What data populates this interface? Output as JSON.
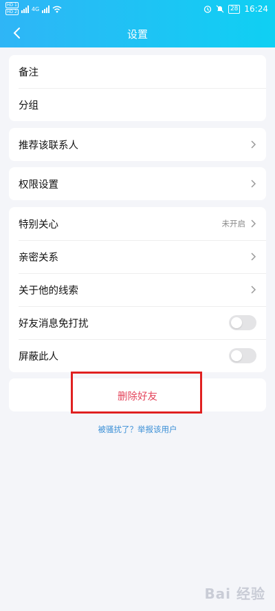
{
  "status_bar": {
    "left_badges": [
      "HD 1",
      "HD 2"
    ],
    "network": "4G",
    "battery": "28",
    "time": "16:24"
  },
  "nav": {
    "title": "设置"
  },
  "groups": [
    {
      "items": [
        {
          "label": "备注"
        },
        {
          "label": "分组"
        }
      ]
    },
    {
      "items": [
        {
          "label": "推荐该联系人"
        }
      ]
    },
    {
      "items": [
        {
          "label": "权限设置"
        }
      ]
    },
    {
      "items": [
        {
          "label": "特别关心",
          "value": "未开启"
        },
        {
          "label": "亲密关系"
        },
        {
          "label": "关于他的线索"
        },
        {
          "label": "好友消息免打扰",
          "toggle": false
        },
        {
          "label": "屏蔽此人",
          "toggle": false
        }
      ]
    }
  ],
  "delete_label": "删除好友",
  "report_link": "被骚扰了？举报该用户",
  "watermark": "Bai 经验",
  "colors": {
    "header_start": "#2fb5f6",
    "header_end": "#0fd0f3",
    "danger": "#e4455c",
    "link": "#3a8fd6",
    "highlight": "#e02020"
  }
}
